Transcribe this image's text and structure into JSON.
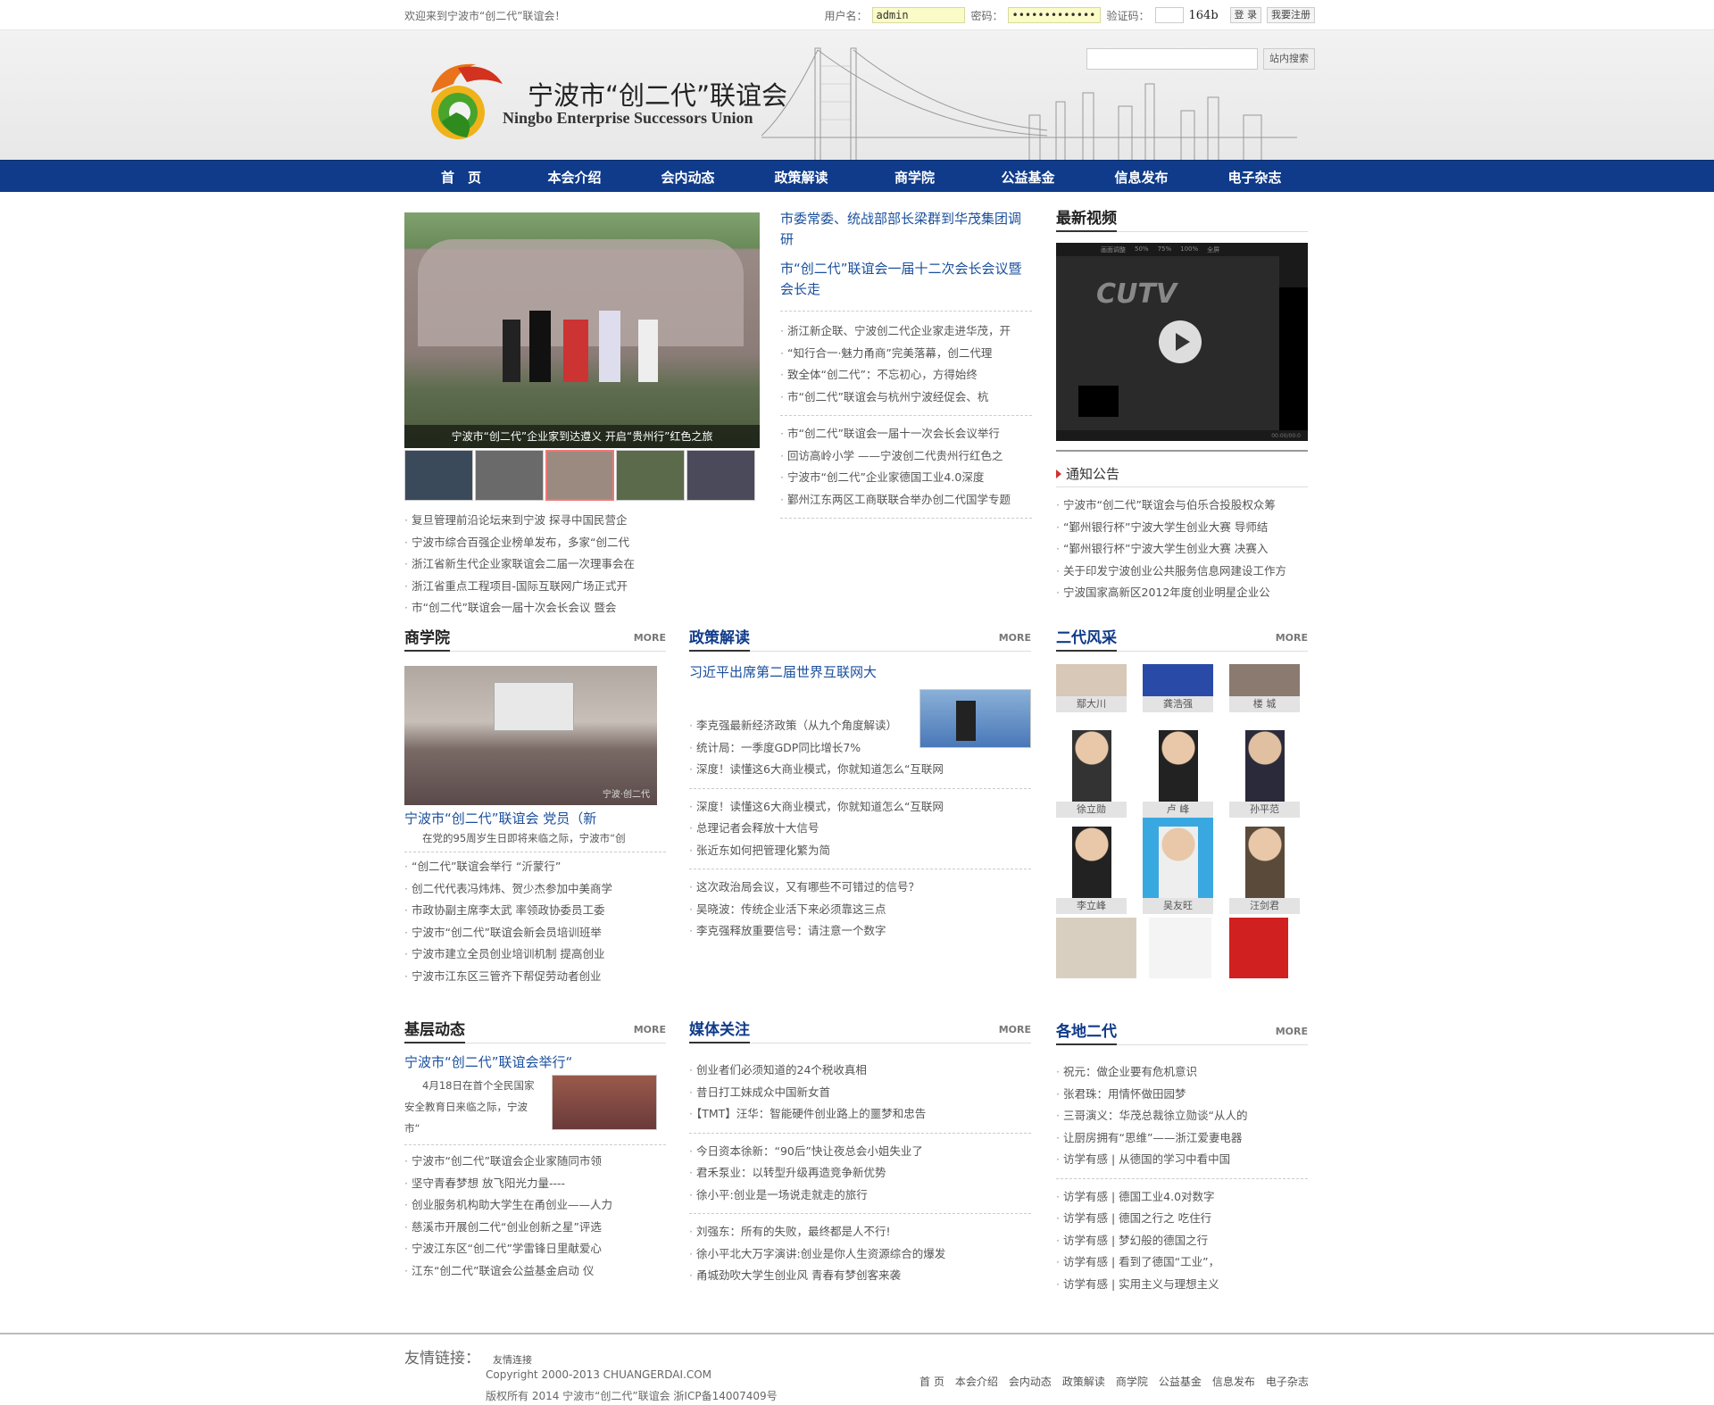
{
  "topbar": {
    "welcome": "欢迎来到宁波市“创二代”联谊会！",
    "user_label": "用户名：",
    "user_value": "admin",
    "pwd_label": "密码：",
    "pwd_value": "••••••••••••••",
    "code_label": "验证码：",
    "code_img": "164b",
    "login": "登 录",
    "register": "我要注册"
  },
  "header": {
    "title": "宁波市“创二代”联谊会",
    "subtitle": "Ningbo Enterprise Successors Union",
    "search_button": "站内搜索"
  },
  "nav": [
    "首　页",
    "本会介绍",
    "会内动态",
    "政策解读",
    "商学院",
    "公益基金",
    "信息发布",
    "电子杂志"
  ],
  "focus": {
    "caption": "宁波市“创二代”企业家到达遵义 开启“贵州行”红色之旅",
    "headline1": "市委常委、统战部部长梁群到华茂集团调研",
    "headline2": "市“创二代”联谊会一届十二次会长会议暨会长走",
    "list_a": [
      "浙江新企联、宁波创二代企业家走进华茂，开",
      "“知行合一·魅力甬商”完美落幕，创二代理",
      "致全体“创二代”：不忘初心，方得始终",
      "市“创二代”联谊会与杭州宁波经促会、杭"
    ],
    "list_b": [
      "市“创二代”联谊会一届十一次会长会议举行",
      "回访高岭小学 ——宁波创二代贵州行红色之",
      "宁波市“创二代”企业家德国工业4.0深度",
      "鄞州江东两区工商联联合举办创二代国学专题"
    ],
    "list_left": [
      "复旦管理前沿论坛来到宁波 探寻中国民营企",
      "宁波市综合百强企业榜单发布，多家“创二代",
      "浙江省新生代企业家联谊会二届一次理事会在",
      "浙江省重点工程项目-国际互联网广场正式开",
      "市“创二代”联谊会一届十次会长会议 暨会"
    ]
  },
  "video": {
    "title": "最新视频",
    "logo": "CUTV",
    "ctrl": [
      "画面调整",
      "50%",
      "75%",
      "100%",
      "全屏"
    ],
    "time": "00:00/00:0"
  },
  "notice": {
    "title": "通知公告",
    "items": [
      "宁波市“创二代”联谊会与伯乐合投股权众筹",
      "“鄞州银行杯”宁波大学生创业大赛 导师结",
      "“鄞州银行杯”宁波大学生创业大赛 决赛入",
      "关于印发宁波创业公共服务信息网建设工作方",
      "宁波国家高新区2012年度创业明星企业公"
    ]
  },
  "more": "MORE",
  "school": {
    "title": "商学院",
    "headline": "宁波市“创二代”联谊会 党员（新",
    "summary": "在党的95周岁生日即将来临之际，宁波市“创",
    "watermark": "宁波·创二代",
    "items": [
      "“创二代”联谊会举行 “沂蒙行”",
      "创二代代表冯炜炜、贺少杰参加中美商学",
      "市政协副主席李太武 率领政协委员工委",
      "宁波市“创二代”联谊会新会员培训班举",
      "宁波市建立全员创业培训机制 提高创业",
      "宁波市江东区三管齐下帮促劳动者创业"
    ]
  },
  "policy": {
    "title": "政策解读",
    "headline": "习近平出席第二届世界互联网大",
    "g1": [
      "李克强最新经济政策（从九个角度解读）",
      "统计局：一季度GDP同比增长7%",
      "深度！读懂这6大商业模式，你就知道怎么“互联网"
    ],
    "g2": [
      "深度！读懂这6大商业模式，你就知道怎么“互联网",
      "总理记者会释放十大信号",
      "张近东如何把管理化繁为简"
    ],
    "g3": [
      "这次政治局会议，又有哪些不可错过的信号？",
      "吴晓波：传统企业活下来必须靠这三点",
      "李克强释放重要信号：请注意一个数字"
    ]
  },
  "people": {
    "title": "二代风采",
    "names": [
      "鄢大川",
      "龚浩强",
      "楼 城",
      "徐立勋",
      "卢 峰",
      "孙平范",
      "李立峰",
      "吴友旺",
      "汪剑君",
      "",
      "",
      ""
    ]
  },
  "grass": {
    "title": "基层动态",
    "headline": "宁波市“创二代”联谊会举行“",
    "summary": "4月18日在首个全民国家安全教育日来临之际，宁波市“",
    "items": [
      "宁波市“创二代”联谊会企业家随同市领",
      "坚守青春梦想 放飞阳光力量----",
      "创业服务机构助大学生在甬创业——人力",
      "慈溪市开展创二代“创业创新之星”评选",
      "宁波江东区“创二代”学雷锋日里献爱心",
      "江东“创二代”联谊会公益基金启动 仪"
    ]
  },
  "media": {
    "title": "媒体关注",
    "g1": [
      "创业者们必须知道的24个税收真相",
      "昔日打工妹成众中国新女首",
      "【TMT】汪华：智能硬件创业路上的噩梦和忠告"
    ],
    "g2": [
      "今日资本徐新：“90后”快让夜总会小姐失业了",
      "君禾泵业：以转型升级再造竞争新优势",
      "徐小平:创业是一场说走就走的旅行"
    ],
    "g3": [
      "刘强东：所有的失败，最终都是人不行!",
      "徐小平北大万字演讲:创业是你人生资源综合的爆发",
      "甬城劲吹大学生创业风 青春有梦创客来袭"
    ]
  },
  "regions": {
    "title": "各地二代",
    "g1": [
      "祝元：做企业要有危机意识",
      "张君珠：用情怀做田园梦",
      "三哥演义：华茂总裁徐立勋谈“从人的",
      "让厨房拥有“思维”——浙江爱妻电器",
      "访学有感 | 从德国的学习中看中国"
    ],
    "g2": [
      "访学有感 | 德国工业4.0对数字",
      "访学有感 | 德国之行之 吃住行",
      "访学有感 | 梦幻般的德国之行",
      "访学有感 | 看到了德国“工业”，",
      "访学有感 | 实用主义与理想主义"
    ]
  },
  "footer": {
    "links_label": "友情链接：",
    "links_item": "友情连接",
    "copyright": "Copyright 2000-2013 CHUANGERDAI.COM",
    "icp": "版权所有 2014 宁波市“创二代”联谊会 浙ICP备14007409号",
    "nav": [
      "首 页",
      "本会介绍",
      "会内动态",
      "政策解读",
      "商学院",
      "公益基金",
      "信息发布",
      "电子杂志"
    ]
  }
}
